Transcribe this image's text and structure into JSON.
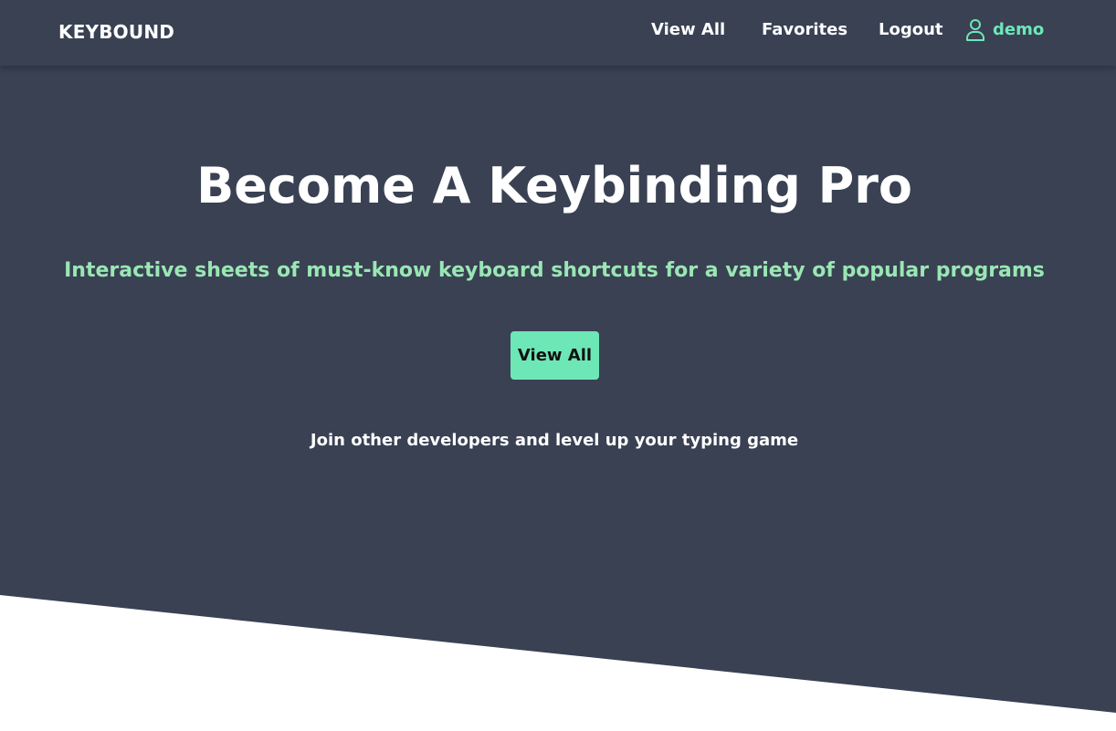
{
  "colors": {
    "background": "#394153",
    "accent": "#6ee7b7",
    "subtitle": "#9ae6b4",
    "text": "#ffffff",
    "footer": "#ffffff"
  },
  "navbar": {
    "brand": "KEYBOUND",
    "links": [
      "View All",
      "Favorites",
      "Logout"
    ],
    "user": {
      "icon": "user-icon",
      "name": "demo"
    }
  },
  "hero": {
    "title": "Become A Keybinding Pro",
    "subtitle": "Interactive sheets of must-know keyboard shortcuts for a variety of popular programs",
    "cta_label": "View All",
    "tagline": "Join other developers and level up your typing game"
  }
}
